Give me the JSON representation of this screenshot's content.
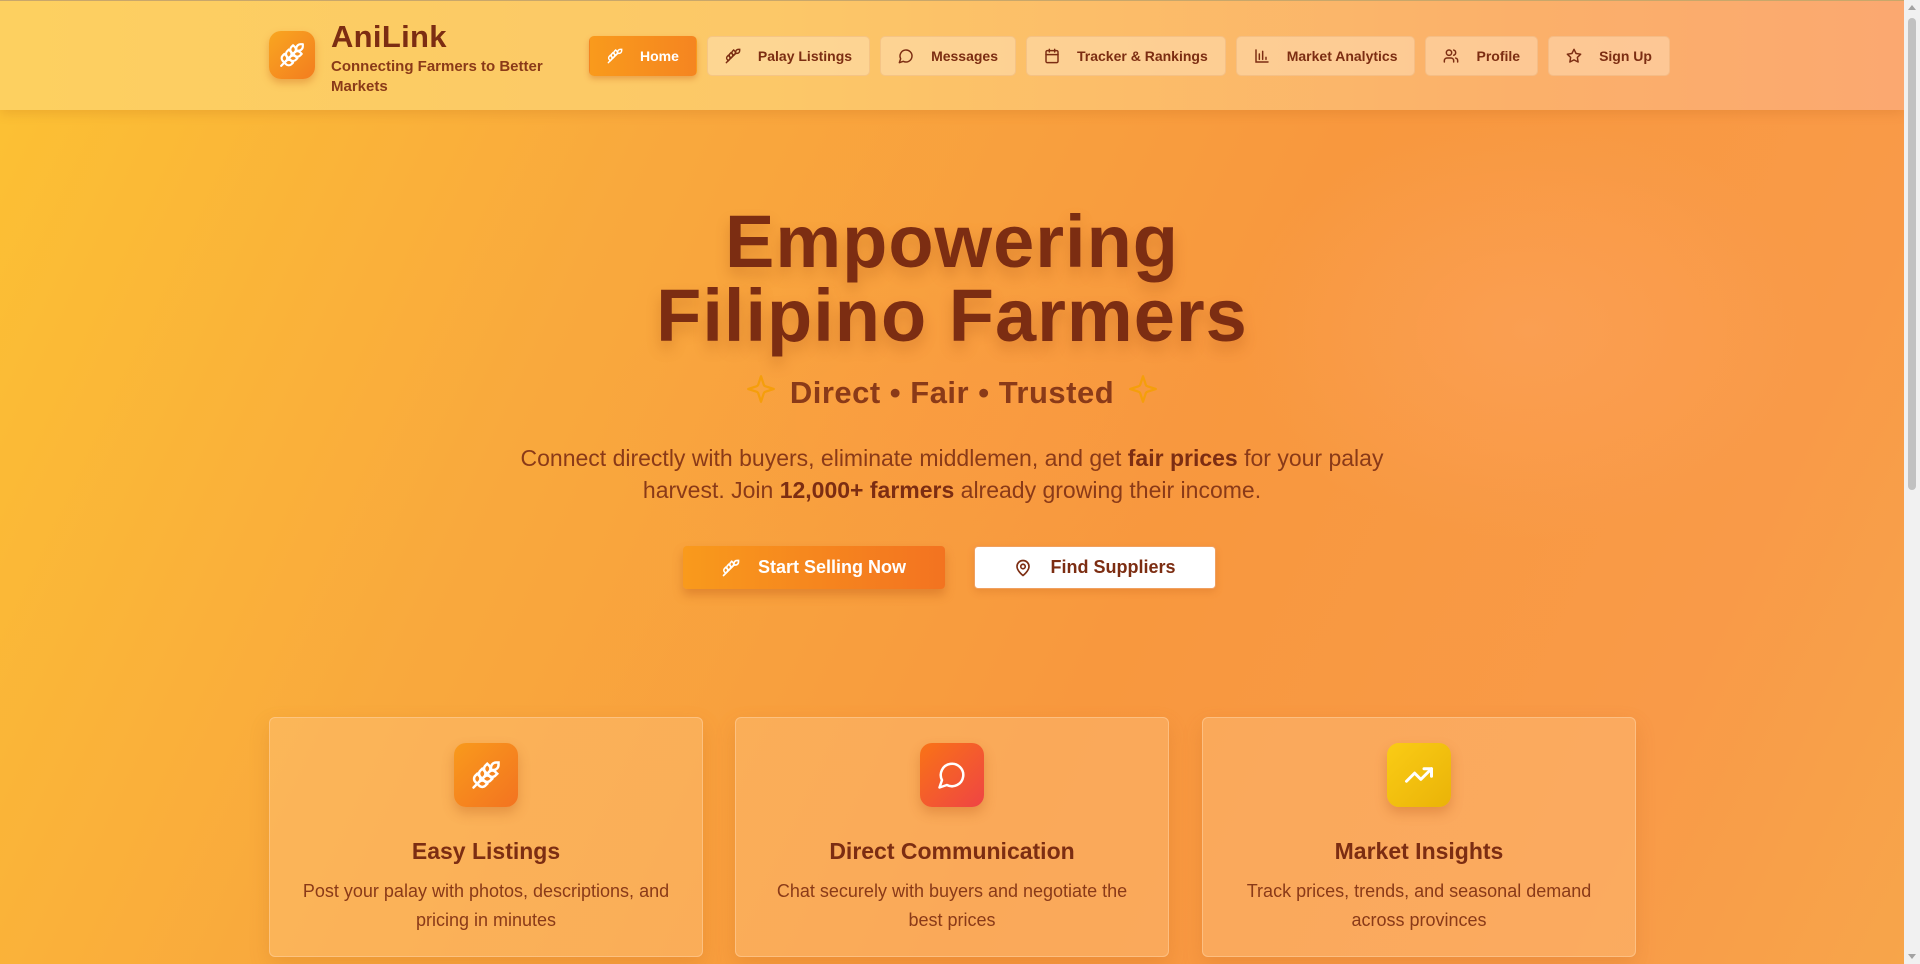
{
  "brand": {
    "name": "AniLink",
    "tagline": "Connecting Farmers to Better Markets",
    "logo_icon": "wheat-icon"
  },
  "nav": {
    "items": [
      {
        "label": "Home",
        "icon": "wheat-icon",
        "active": true
      },
      {
        "label": "Palay Listings",
        "icon": "wheat-icon"
      },
      {
        "label": "Messages",
        "icon": "chat-icon"
      },
      {
        "label": "Tracker & Rankings",
        "icon": "calendar-icon"
      },
      {
        "label": "Market Analytics",
        "icon": "bar-chart-icon"
      },
      {
        "label": "Profile",
        "icon": "users-icon"
      },
      {
        "label": "Sign Up",
        "icon": "star-icon"
      }
    ]
  },
  "hero": {
    "title_line1": "Empowering",
    "title_line2": "Filipino Farmers",
    "subtitle": "Direct • Fair • Trusted",
    "desc_part1": "Connect directly with buyers, eliminate middlemen, and get ",
    "desc_bold1": "fair prices",
    "desc_part2": " for your palay harvest. Join ",
    "desc_bold2": "12,000+ farmers",
    "desc_part3": " already growing their income.",
    "cta_primary": "Start Selling Now",
    "cta_secondary": "Find Suppliers"
  },
  "features": [
    {
      "title": "Easy Listings",
      "text": "Post your palay with photos, descriptions, and pricing in minutes",
      "icon": "wheat-icon"
    },
    {
      "title": "Direct Communication",
      "text": "Chat securely with buyers and negotiate the best prices",
      "icon": "chat-icon"
    },
    {
      "title": "Market Insights",
      "text": "Track prices, trends, and seasonal demand across provinces",
      "icon": "trending-up-icon"
    }
  ],
  "colors": {
    "primary": "#f58520",
    "text": "#7c2d12",
    "accent_yellow": "#eab308",
    "accent_red": "#ef4444"
  }
}
